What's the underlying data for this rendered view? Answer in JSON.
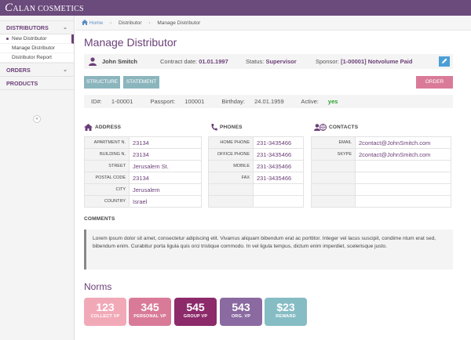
{
  "app": {
    "logo_big": "C",
    "logo_rest": "ALAN COSMETICS"
  },
  "sidebar": {
    "distributors": "DISTRIBUTORS",
    "items": [
      "New Distributor",
      "Manage Distributor",
      "Distributor Report"
    ],
    "orders": "ORDERS",
    "products": "PRODUCTS",
    "collapse": "«"
  },
  "breadcrumb": {
    "home": "Home",
    "level1": "Distributor",
    "level2": "Manage Distributor"
  },
  "page": {
    "title": "Manage Distributor"
  },
  "info": {
    "name": "John Smitch",
    "contract_label": "Contract date:",
    "contract_value": "01.01.1997",
    "status_label": "Status:",
    "status_value": "Supervisor",
    "sponsor_label": "Sponsor:",
    "sponsor_value": "[1-00001] Notvolume Paid"
  },
  "buttons": {
    "structure": "STRUCTURE",
    "statement": "STATEMENT",
    "order": "ORDER"
  },
  "ids": {
    "id_label": "ID#:",
    "id_value": "1-00001",
    "passport_label": "Passport:",
    "passport_value": "100001",
    "birthday_label": "Birthday:",
    "birthday_value": "24.01.1959",
    "active_label": "Active:",
    "active_value": "yes"
  },
  "address": {
    "title": "ADDRESS",
    "rows": [
      {
        "k": "APARTMENT N.",
        "v": "23134"
      },
      {
        "k": "BUILDING N.",
        "v": "23134"
      },
      {
        "k": "STREET",
        "v": "Jerusalem St."
      },
      {
        "k": "POSTAL CODE",
        "v": "23134"
      },
      {
        "k": "CITY",
        "v": "Jerusalem"
      },
      {
        "k": "COUNTRY",
        "v": "Israel"
      }
    ]
  },
  "phones": {
    "title": "PHONES",
    "rows": [
      {
        "k": "HOME PHONE",
        "v": "231-3435466"
      },
      {
        "k": "OFFICE PHONE",
        "v": "231-3435466"
      },
      {
        "k": "MOBILE",
        "v": "231-3435466"
      },
      {
        "k": "FAX",
        "v": "231-3435466"
      },
      {
        "k": "",
        "v": ""
      },
      {
        "k": "",
        "v": ""
      }
    ]
  },
  "contacts": {
    "title": "CONTACTS",
    "rows": [
      {
        "k": "EMAIL",
        "v": "2contact@JohnSmitch.com"
      },
      {
        "k": "SKYPE",
        "v": "2contact@JohnSmitch.com"
      },
      {
        "k": "",
        "v": ""
      },
      {
        "k": "",
        "v": ""
      },
      {
        "k": "",
        "v": ""
      },
      {
        "k": "",
        "v": ""
      }
    ]
  },
  "comments": {
    "title": "COMMENTS",
    "text": "Lorem ipsum dolor sit amet, consectetur adipiscing elit. Vivamus aliquam bibendum erat ac porttitor. Integer vel lacus suscipit, condime ntum erat sed, bibendum enim. Curabitur porta ligula quis orci tristique commodo. In vel ligula tempus, dictum enim imperdiet, scelerisque justo."
  },
  "norms": {
    "title": "Norms",
    "cards": [
      {
        "value": "123",
        "label": "COLLECT VP",
        "color": "#f2a9b7"
      },
      {
        "value": "345",
        "label": "PERSONAL VP",
        "color": "#d97b98"
      },
      {
        "value": "545",
        "label": "GROUP VP",
        "color": "#8c2a6a"
      },
      {
        "value": "543",
        "label": "ORG. VP",
        "color": "#8a6aa0"
      },
      {
        "value": "$23",
        "label": "REWARD",
        "color": "#86bcc4"
      }
    ]
  },
  "colors": {
    "brand": "#6b4a7c",
    "accent": "#6b3f78",
    "edit": "#4b9fd6"
  }
}
